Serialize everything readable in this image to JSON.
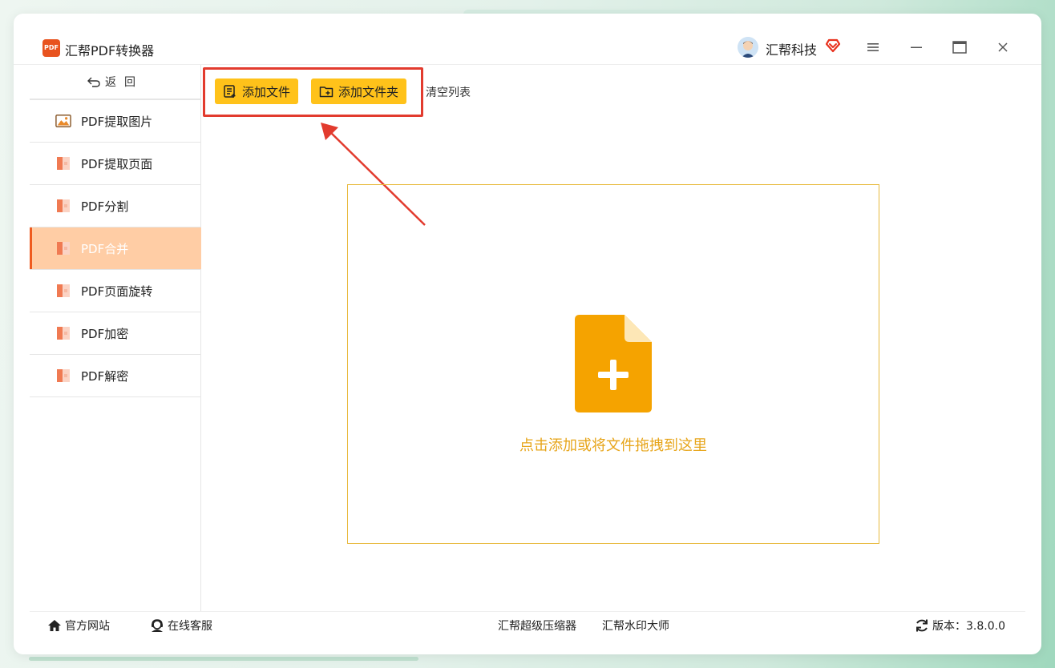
{
  "app": {
    "title": "汇帮PDF转换器",
    "logo_text": "PDF",
    "user_name": "汇帮科技"
  },
  "sidebar": {
    "back_label": "返回",
    "items": [
      {
        "label": "PDF提取图片",
        "icon": "image-icon"
      },
      {
        "label": "PDF提取页面",
        "icon": "pdf-file-icon"
      },
      {
        "label": "PDF分割",
        "icon": "pdf-file-icon"
      },
      {
        "label": "PDF合并",
        "icon": "pdf-file-icon",
        "active": true
      },
      {
        "label": "PDF页面旋转",
        "icon": "pdf-file-icon"
      },
      {
        "label": "PDF加密",
        "icon": "pdf-file-icon"
      },
      {
        "label": "PDF解密",
        "icon": "pdf-file-icon"
      }
    ]
  },
  "toolbar": {
    "add_file_label": "添加文件",
    "add_folder_label": "添加文件夹",
    "clear_list_label": "清空列表"
  },
  "dropzone": {
    "text": "点击添加或将文件拖拽到这里"
  },
  "footer": {
    "website_label": "官方网站",
    "support_label": "在线客服",
    "compressor_label": "汇帮超级压缩器",
    "watermark_label": "汇帮水印大师",
    "version_label": "版本：3.8.0.0"
  },
  "colors": {
    "accent_yellow": "#ffc21a",
    "active_nav": "#ffcda5",
    "drop_orange": "#f5a300",
    "highlight_red": "#e23b2e"
  }
}
